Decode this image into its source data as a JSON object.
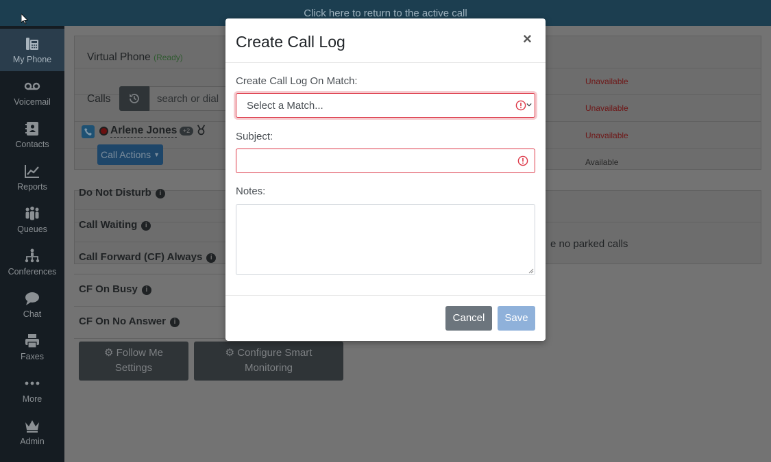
{
  "topbar": {
    "return_text": "Click here to return to the active call"
  },
  "sidebar": {
    "items": [
      {
        "label": "My Phone",
        "icon": "phone-icon",
        "active": true
      },
      {
        "label": "Voicemail",
        "icon": "voicemail-icon"
      },
      {
        "label": "Contacts",
        "icon": "contacts-icon"
      },
      {
        "label": "Reports",
        "icon": "chart-line-icon"
      },
      {
        "label": "Queues",
        "icon": "users-icon"
      },
      {
        "label": "Conferences",
        "icon": "sitemap-icon"
      },
      {
        "label": "Chat",
        "icon": "chat-icon"
      },
      {
        "label": "Faxes",
        "icon": "printer-icon"
      },
      {
        "label": "More",
        "icon": "ellipsis-icon"
      },
      {
        "label": "Admin",
        "icon": "crown-icon"
      }
    ]
  },
  "virtual_phone": {
    "title": "Virtual Phone",
    "status": "(Ready)",
    "presence": [
      "Unavailable",
      "Unavailable",
      "Unavailable",
      "Available"
    ]
  },
  "calls": {
    "label": "Calls",
    "search_placeholder": "search or dial",
    "caller_name": "Arlene Jones",
    "extra_count": "+2",
    "call_actions_label": "Call Actions"
  },
  "settings": {
    "rows": [
      "Do Not Disturb",
      "Call Waiting",
      "Call Forward (CF) Always",
      "CF On Busy",
      "CF On No Answer"
    ],
    "follow_me_line1": "Follow Me",
    "follow_me_line2": "Settings",
    "smart_line1": "Configure Smart",
    "smart_line2": "Monitoring"
  },
  "parked": {
    "empty_text": "e no parked calls"
  },
  "modal": {
    "title": "Create Call Log",
    "close_symbol": "×",
    "match_label": "Create Call Log On Match:",
    "match_placeholder": "Select a Match...",
    "subject_label": "Subject:",
    "notes_label": "Notes:",
    "cancel_label": "Cancel",
    "save_label": "Save"
  },
  "colors": {
    "topbar": "#1c3e50",
    "sidebar": "#151c22",
    "error": "#dc3545",
    "save_disabled": "#8fb1da",
    "cancel": "#6c757d"
  }
}
